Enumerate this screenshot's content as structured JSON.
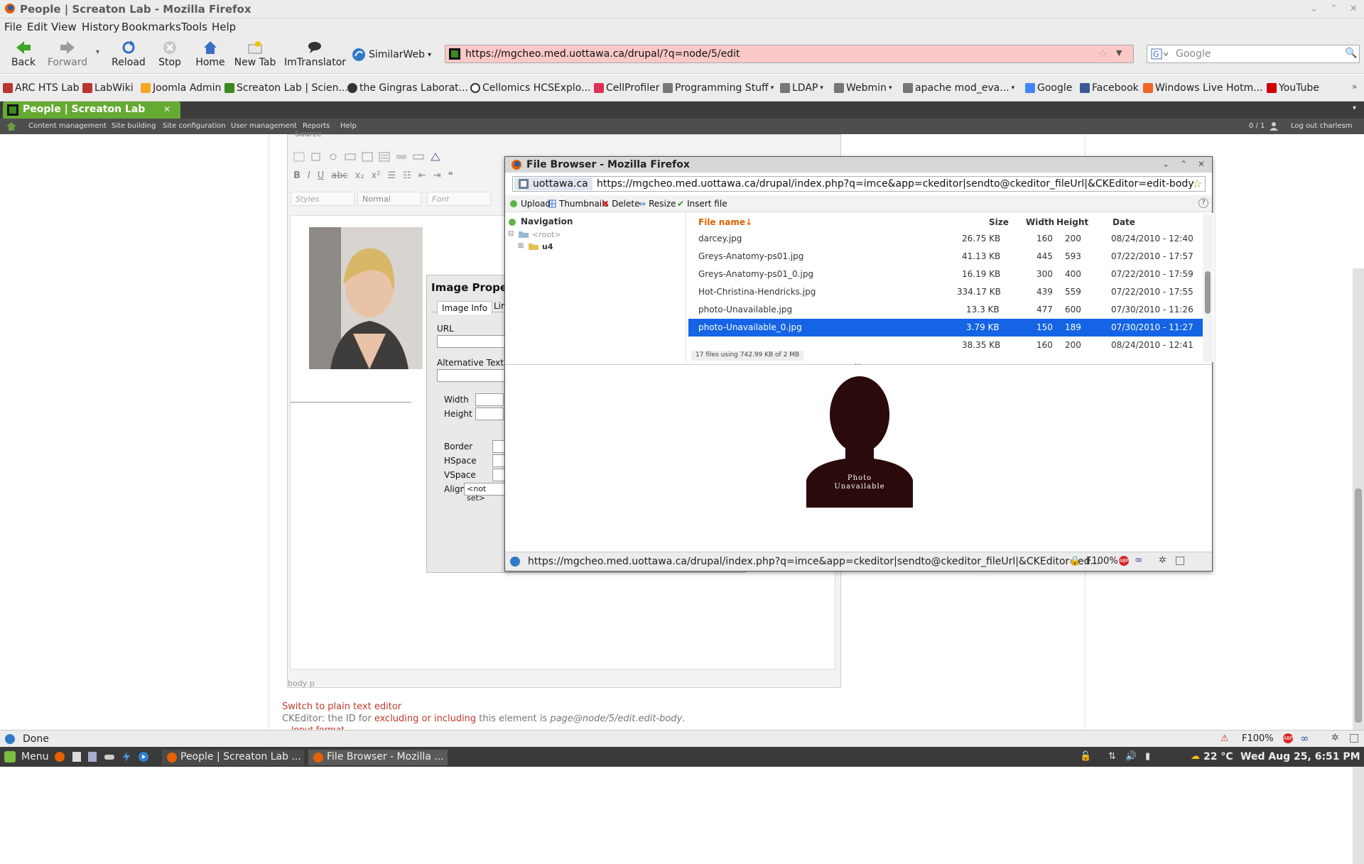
{
  "window": {
    "title": "People | Screaton Lab - Mozilla Firefox"
  },
  "menu": [
    "File",
    "Edit",
    "View",
    "History",
    "Bookmarks",
    "Tools",
    "Help"
  ],
  "nav": {
    "back": "Back",
    "forward": "Forward",
    "reload": "Reload",
    "stop": "Stop",
    "home": "Home",
    "new_tab": "New Tab",
    "imtranslator": "ImTranslator",
    "similarweb": "SimilarWeb"
  },
  "url": "https://mgcheo.med.uottawa.ca/drupal/?q=node/5/edit",
  "search": {
    "placeholder": "Google"
  },
  "bookmarks": [
    "ARC HTS Lab",
    "LabWiki",
    "Joomla Admin",
    "Screaton Lab | Scien...",
    "the Gingras Laborat...",
    "Cellomics HCSExplo...",
    "CellProfiler",
    "Programming Stuff",
    "LDAP",
    "Webmin",
    "apache mod_eva...",
    "Google",
    "Facebook",
    "Windows Live Hotm...",
    "YouTube"
  ],
  "tab": {
    "label": "People | Screaton Lab"
  },
  "admin": {
    "items": [
      "Content management",
      "Site building",
      "Site configuration",
      "User management",
      "Reports",
      "Help"
    ],
    "right_count": "0 / 1",
    "logout": "Log out charlesm"
  },
  "editor": {
    "source": "Source",
    "styles": "Styles",
    "format": "Normal",
    "font": "Font",
    "path": "body  p"
  },
  "image_props": {
    "title": "Image Propertie",
    "tabs": [
      "Image Info",
      "Lin"
    ],
    "url": "URL",
    "alt": "Alternative Text",
    "width": "Width",
    "height": "Height",
    "border": "Border",
    "hspace": "HSpace",
    "vspace": "VSpace",
    "align": "Align",
    "align_value": "<not set>"
  },
  "page": {
    "switch": "Switch to plain text editor",
    "note_pre": "CKEditor: the ID for ",
    "note_link": "excluding or including",
    "note_mid": " this element is ",
    "note_id": "page@node/5/edit.edit-body",
    "note_end": ".",
    "input_format": "Input format"
  },
  "popup": {
    "title": "File Browser - Mozilla Firefox",
    "domain": "uottawa.ca",
    "url": "https://mgcheo.med.uottawa.ca/drupal/index.php?q=imce&app=ckeditor|sendto@ckeditor_fileUrl|&CKEditor=edit-body&CKEditor",
    "toolbar": {
      "upload": "Upload",
      "thumbnails": "Thumbnails",
      "delete": "Delete",
      "resize": "Resize",
      "insert": "Insert file",
      "help": "?"
    },
    "nav": {
      "header": "Navigation",
      "root": "<root>",
      "folder": "u4"
    },
    "columns": {
      "name": "File name↓",
      "size": "Size",
      "width": "Width",
      "height": "Height",
      "date": "Date"
    },
    "files": [
      {
        "name": "darcey.jpg",
        "size": "26.75 KB",
        "width": "160",
        "height": "200",
        "date": "08/24/2010 - 12:40"
      },
      {
        "name": "Greys-Anatomy-ps01.jpg",
        "size": "41.13 KB",
        "width": "445",
        "height": "593",
        "date": "07/22/2010 - 17:57"
      },
      {
        "name": "Greys-Anatomy-ps01_0.jpg",
        "size": "16.19 KB",
        "width": "300",
        "height": "400",
        "date": "07/22/2010 - 17:59"
      },
      {
        "name": "Hot-Christina-Hendricks.jpg",
        "size": "334.17 KB",
        "width": "439",
        "height": "559",
        "date": "07/22/2010 - 17:55"
      },
      {
        "name": "photo-Unavailable.jpg",
        "size": "13.3 KB",
        "width": "477",
        "height": "600",
        "date": "07/30/2010 - 11:26"
      },
      {
        "name": "photo-Unavailable_0.jpg",
        "size": "3.79 KB",
        "width": "150",
        "height": "189",
        "date": "07/30/2010 - 11:27"
      },
      {
        "name": "",
        "size": "38.35 KB",
        "width": "160",
        "height": "200",
        "date": "08/24/2010 - 12:41"
      }
    ],
    "summary": "17 files using 742.99 KB of 2 MB",
    "preview_text_1": "Photo",
    "preview_text_2": "Unavailable",
    "status_url": "https://mgcheo.med.uottawa.ca/drupal/index.php?q=imce&app=ckeditor|sendto@ckeditor_fileUrl|&CKEditor=ed...",
    "zoom": "F100%"
  },
  "statusbar": {
    "text": "Done",
    "zoom": "F100%"
  },
  "taskbar": {
    "menu": "Menu",
    "task1": "People | Screaton Lab ...",
    "task2": "File Browser - Mozilla ...",
    "weather": "22 °C",
    "datetime": "Wed Aug 25,  6:51 PM"
  }
}
